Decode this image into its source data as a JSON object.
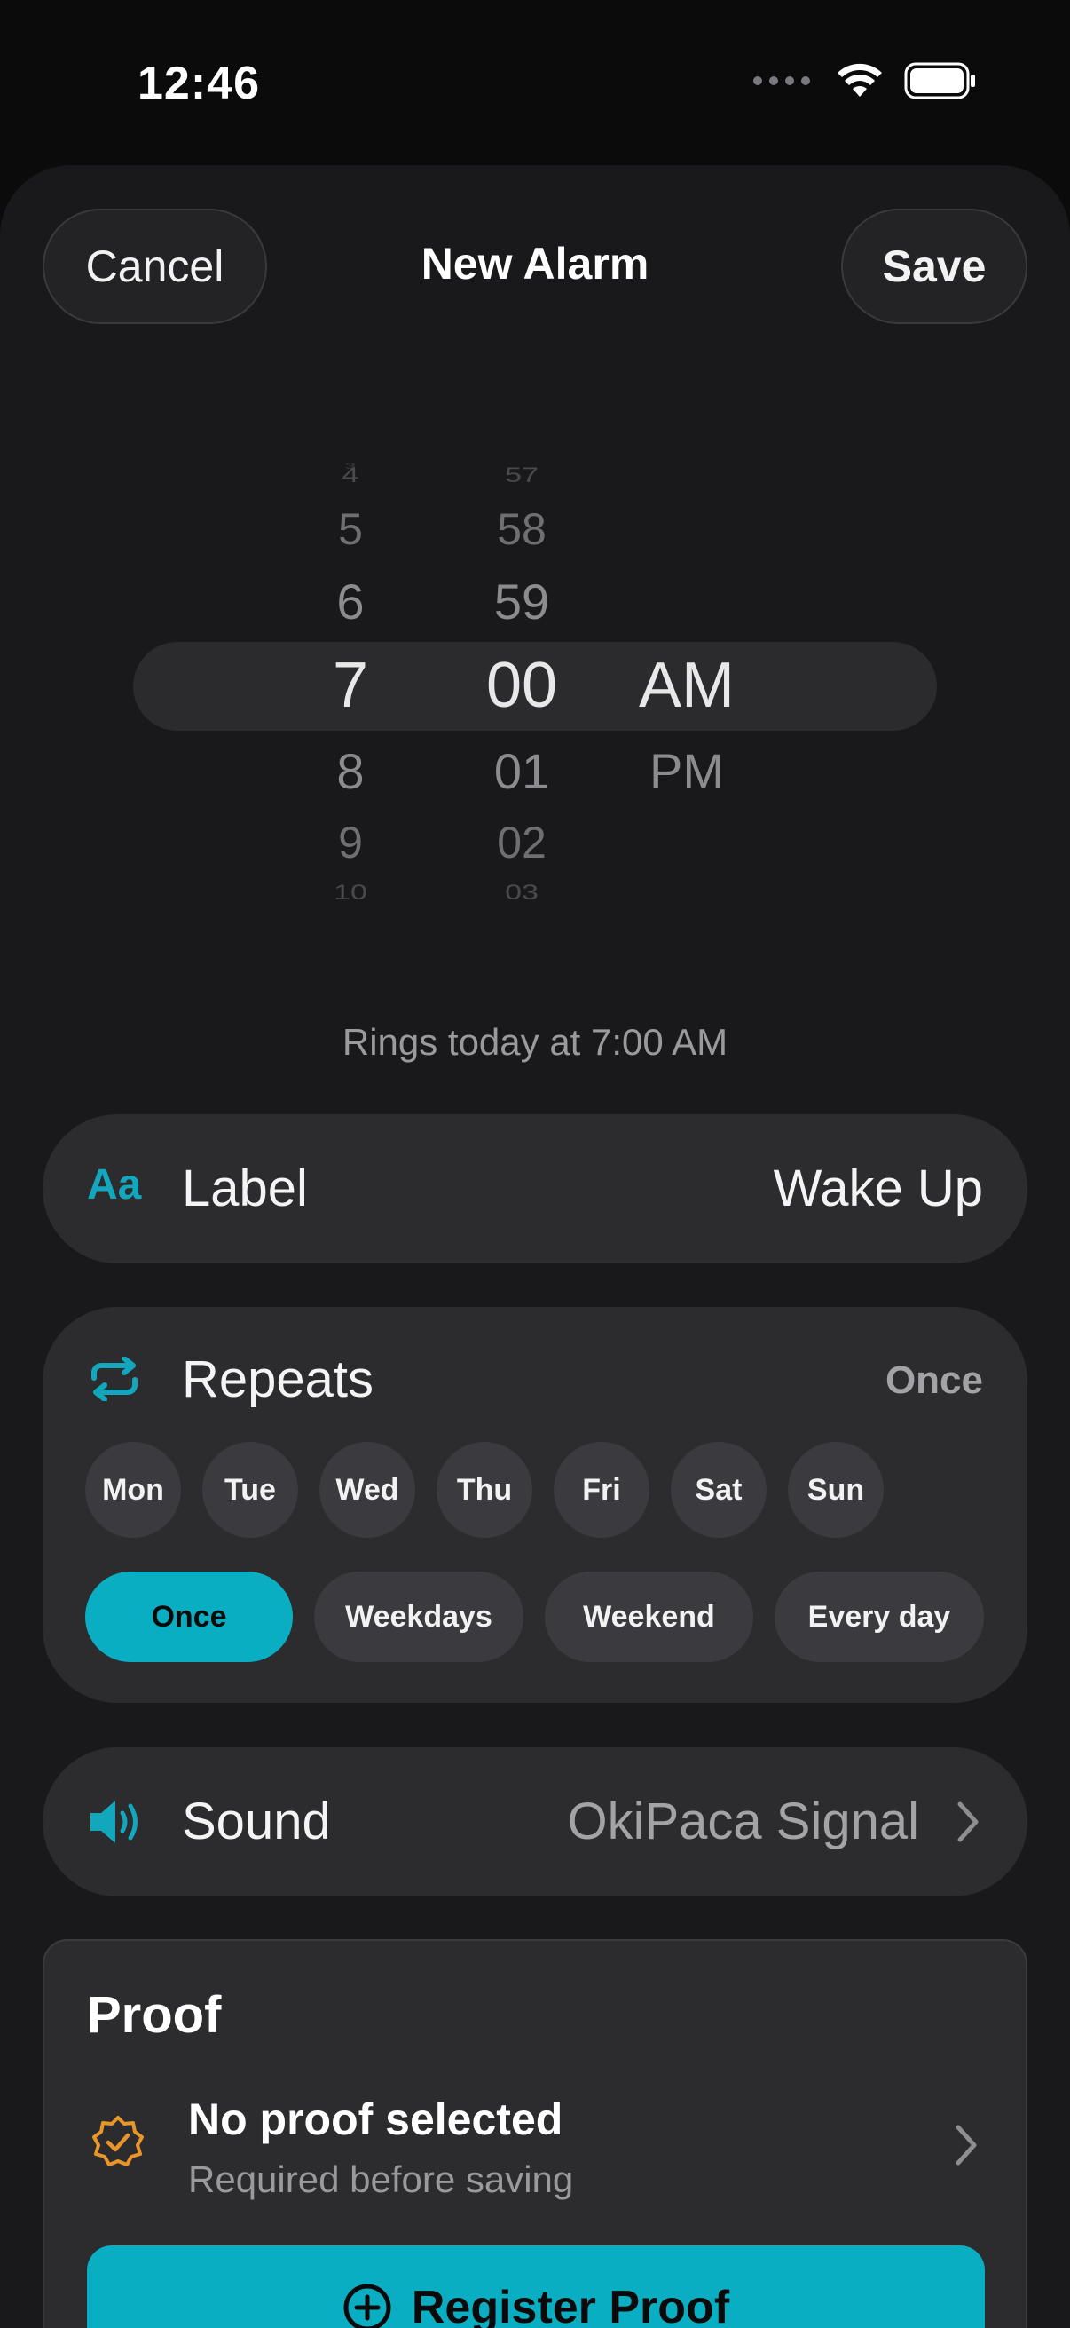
{
  "status_bar": {
    "time": "12:46"
  },
  "nav": {
    "cancel_label": "Cancel",
    "title": "New Alarm",
    "save_label": "Save"
  },
  "time_picker": {
    "hours": [
      "4",
      "5",
      "6",
      "7",
      "8",
      "9",
      "10"
    ],
    "minutes": [
      "57",
      "58",
      "59",
      "00",
      "01",
      "02",
      "03"
    ],
    "periods": [
      "AM",
      "PM"
    ],
    "selected_hour": "7",
    "selected_minute": "00",
    "selected_period": "AM"
  },
  "rings_note": "Rings today at 7:00 AM",
  "label_row": {
    "icon_text": "Aa",
    "title": "Label",
    "value": "Wake Up"
  },
  "repeats": {
    "title": "Repeats",
    "value": "Once",
    "days": [
      "Mon",
      "Tue",
      "Wed",
      "Thu",
      "Fri",
      "Sat",
      "Sun"
    ],
    "presets": [
      "Once",
      "Weekdays",
      "Weekend",
      "Every day"
    ],
    "active_preset": "Once"
  },
  "sound_row": {
    "title": "Sound",
    "value": "OkiPaca Signal"
  },
  "proof": {
    "title": "Proof",
    "status": "No proof selected",
    "subtitle": "Required before saving",
    "register_label": "Register Proof"
  },
  "colors": {
    "accent": "#0aaec2",
    "warning": "#e8962a"
  }
}
